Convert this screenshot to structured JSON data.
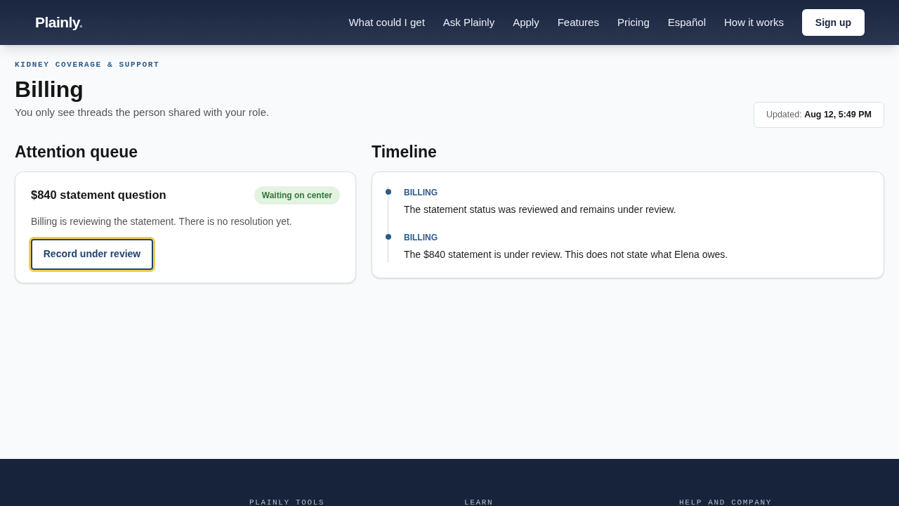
{
  "header": {
    "logo": "Plainly",
    "logo_dot": ".",
    "nav": [
      "What could I get",
      "Ask Plainly",
      "Apply",
      "Features",
      "Pricing",
      "Español",
      "How it works"
    ],
    "cta": "Sign up"
  },
  "page": {
    "eyebrow": "KIDNEY COVERAGE & SUPPORT",
    "title": "Billing",
    "subtitle": "You only see threads the person shared with your role.",
    "updated_label": "Updated:",
    "updated_value": "Aug 12, 5:49 PM"
  },
  "queue": {
    "heading": "Attention queue",
    "items": [
      {
        "title": "$840 statement question",
        "status": "Waiting on center",
        "color": "#2f7a3a",
        "body": "Billing is reviewing the statement. There is no resolution yet.",
        "action": "Record under review",
        "focused": true
      }
    ]
  },
  "timeline": {
    "heading": "Timeline",
    "entries": [
      {
        "tag": "BILLING",
        "text": "The statement status was reviewed and remains under review."
      },
      {
        "tag": "BILLING",
        "text": "The $840 statement is under review. This does not state what Elena owes."
      }
    ]
  },
  "footer": {
    "columns": [
      "PLAINLY TOOLS",
      "LEARN",
      "HELP AND COMPANY"
    ]
  }
}
